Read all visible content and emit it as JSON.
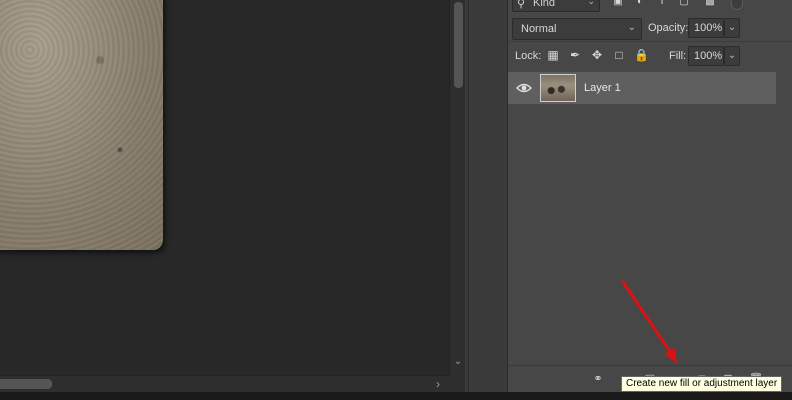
{
  "layers_panel": {
    "filter": {
      "kind_label": "Kind"
    },
    "blend_mode": "Normal",
    "opacity_label": "Opacity:",
    "opacity_value": "100%",
    "lock_label": "Lock:",
    "fill_label": "Fill:",
    "fill_value": "100%",
    "layers": [
      {
        "name": "Layer 1",
        "visible": true,
        "selected": true
      }
    ],
    "toolbar_icons": [
      "link-layers-icon",
      "fx-icon",
      "add-mask-icon",
      "new-fill-adjustment-icon",
      "new-group-icon",
      "new-layer-icon",
      "delete-icon"
    ]
  },
  "tooltip": {
    "text": "Create new fill or adjustment layer"
  },
  "colors": {
    "panel_bg": "#474747",
    "selected_layer_bg": "#5f5f5f",
    "canvas_bg": "#282828",
    "tooltip_bg": "#ffffe1",
    "annotation_arrow": "#e01010"
  }
}
